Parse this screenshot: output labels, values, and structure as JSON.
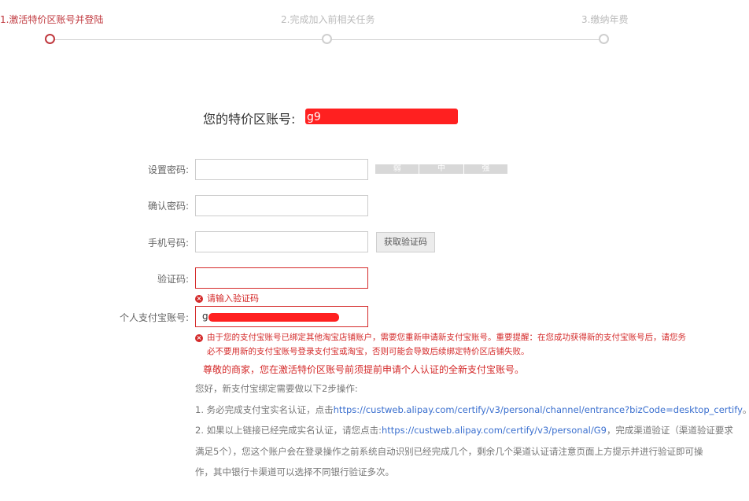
{
  "steps": [
    {
      "label": "1.激活特价区账号并登陆",
      "active": true
    },
    {
      "label": "2.完成加入前相关任务",
      "active": false
    },
    {
      "label": "3.缴纳年费",
      "active": false
    }
  ],
  "account": {
    "label": "您的特价区账号:",
    "value_redacted": "g9　　　　　　　　　　　"
  },
  "form": {
    "password_label": "设置密码:",
    "strength": [
      "弱",
      "中",
      "强"
    ],
    "confirm_label": "确认密码:",
    "phone_label": "手机号码:",
    "get_code_button": "获取验证码",
    "code_label": "验证码:",
    "code_error": "请输入验证码",
    "alipay_label": "个人支付宝账号:",
    "alipay_value": "g",
    "alipay_error_line1": "由于您的支付宝账号已绑定其他淘宝店铺账户，需要您重新申请新支付宝账号。重要提醒：在您成功获得新的支付宝账号后，请您务",
    "alipay_error_line2": "必不要用新的支付宝账号登录支付宝或淘宝，否则可能会导致后续绑定特价区店铺失败。"
  },
  "notice": "尊敬的商家，您在激活特价区账号前须提前申请个人认证的全新支付宝账号。",
  "instructions": {
    "intro": "您好，新支付宝绑定需要做以下2步操作:",
    "step1_prefix": "1. 务必完成支付宝实名认证，点击",
    "step1_link": "https://custweb.alipay.com/certify/v3/personal/channel/entrance?bizCode=desktop_certify",
    "step1_suffix": "。",
    "step2_prefix": "2. 如果以上链接已经完成实名认证，请您点击:",
    "step2_link": "https://custweb.alipay.com/certify/v3/personal/G9",
    "step2_suffix": "，完成渠道验证（渠道验证要求",
    "step2_line2": "满足5个），您这个账户会在登录操作之前系统自动识别已经完成几个，剩余几个渠道认证请注意页面上方提示并进行验证即可操",
    "step2_line3": "作，其中银行卡渠道可以选择不同银行验证多次。"
  },
  "colors": {
    "accent": "#c0393f",
    "error": "#d42a2a",
    "link": "#3a6fcf"
  }
}
